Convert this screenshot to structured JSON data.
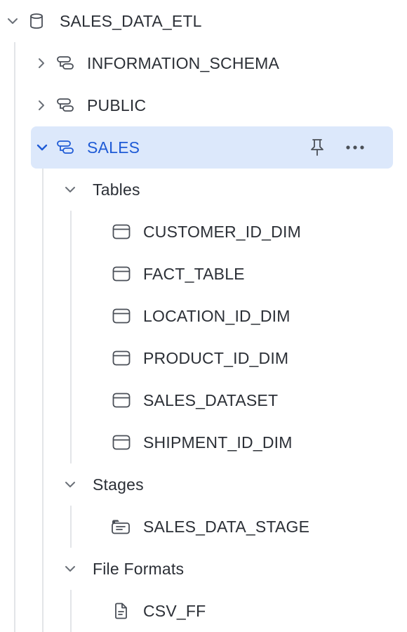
{
  "database": {
    "name": "SALES_DATA_ETL",
    "icon": "database-icon",
    "expanded": true
  },
  "schemas": [
    {
      "name": "INFORMATION_SCHEMA",
      "icon": "schema-icon",
      "expanded": false
    },
    {
      "name": "PUBLIC",
      "icon": "schema-icon",
      "expanded": false
    },
    {
      "name": "SALES",
      "icon": "schema-icon",
      "expanded": true,
      "selected": true,
      "actions": [
        "pin-icon",
        "more-icon"
      ]
    }
  ],
  "sales": {
    "groups": [
      {
        "label": "Tables",
        "expanded": true,
        "items": [
          "CUSTOMER_ID_DIM",
          "FACT_TABLE",
          "LOCATION_ID_DIM",
          "PRODUCT_ID_DIM",
          "SALES_DATASET",
          "SHIPMENT_ID_DIM"
        ],
        "item_icon": "table-icon"
      },
      {
        "label": "Stages",
        "expanded": true,
        "items": [
          "SALES_DATA_STAGE"
        ],
        "item_icon": "stage-icon"
      },
      {
        "label": "File Formats",
        "expanded": true,
        "items": [
          "CSV_FF"
        ],
        "item_icon": "file-format-icon"
      }
    ]
  },
  "colors": {
    "selected_bg": "#dce8fb",
    "selected_text": "#1f5bd6",
    "text": "#2b2f36",
    "icon": "#4a4f57",
    "guide": "#e3e5e8"
  }
}
